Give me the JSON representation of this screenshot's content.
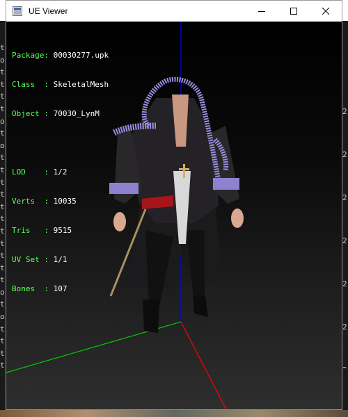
{
  "window": {
    "title": "UE Viewer"
  },
  "info": {
    "package_label": "Package: ",
    "package_value": "00030277.upk",
    "class_label": "Class  : ",
    "class_value": "SkeletalMesh",
    "object_label": "Object : ",
    "object_value": "70030_LynM",
    "lod_label": "LOD    : ",
    "lod_value": "1/2",
    "verts_label": "Verts  : ",
    "verts_value": "10035",
    "tris_label": "Tris   : ",
    "tris_value": "9515",
    "uvset_label": "UV Set : ",
    "uvset_value": "1/1",
    "bones_label": "Bones  : ",
    "bones_value": "107"
  },
  "colors": {
    "label": "#5cff5c",
    "value": "#ffffff",
    "axis_x": "#ff0000",
    "axis_y": "#00cc00",
    "axis_z": "#0000ff"
  },
  "background": {
    "left_chars": "t\no\nt\nt\nt\nt\no\nt\no\nt\nt\nt\nt\nt\nt\nt\nt\nt\nt\nt\no\nt\no\nt\nt\nt\nt\nt",
    "right_chars": "2\n2\n2\n2\n2\n2\n2"
  },
  "icons": {
    "app": "ue-app-icon",
    "minimize": "minimize-icon",
    "maximize": "maximize-icon",
    "close": "close-icon"
  }
}
